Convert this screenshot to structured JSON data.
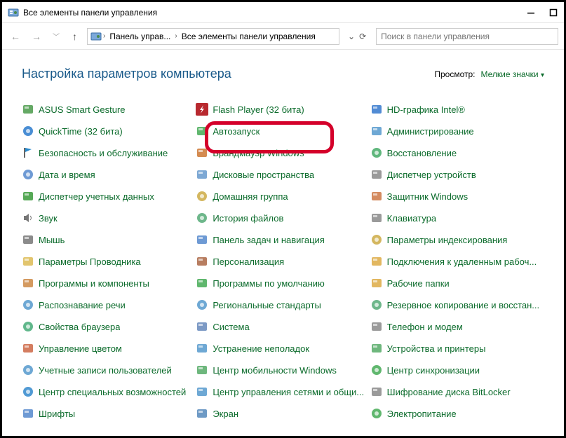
{
  "window": {
    "title": "Все элементы панели управления"
  },
  "breadcrumbs": {
    "part1": "Панель управ...",
    "part2": "Все элементы панели управления"
  },
  "search": {
    "placeholder": "Поиск в панели управления"
  },
  "page": {
    "title": "Настройка параметров компьютера"
  },
  "view": {
    "label": "Просмотр:",
    "value": "Мелкие значки"
  },
  "highlight_emphasis": true,
  "columns": [
    [
      {
        "icon": "asus-icon",
        "label": "ASUS Smart Gesture"
      },
      {
        "icon": "quicktime-icon",
        "label": "QuickTime (32 бита)"
      },
      {
        "icon": "flag-icon",
        "label": "Безопасность и обслуживание"
      },
      {
        "icon": "clock-icon",
        "label": "Дата и время"
      },
      {
        "icon": "credentials-icon",
        "label": "Диспетчер учетных данных"
      },
      {
        "icon": "sound-icon",
        "label": "Звук"
      },
      {
        "icon": "mouse-icon",
        "label": "Мышь"
      },
      {
        "icon": "explorer-options-icon",
        "label": "Параметры Проводника"
      },
      {
        "icon": "programs-icon",
        "label": "Программы и компоненты"
      },
      {
        "icon": "speech-icon",
        "label": "Распознавание речи"
      },
      {
        "icon": "browser-props-icon",
        "label": "Свойства браузера"
      },
      {
        "icon": "color-mgmt-icon",
        "label": "Управление цветом"
      },
      {
        "icon": "user-accounts-icon",
        "label": "Учетные записи пользователей"
      },
      {
        "icon": "ease-access-icon",
        "label": "Центр специальных возможностей"
      },
      {
        "icon": "fonts-icon",
        "label": "Шрифты"
      }
    ],
    [
      {
        "icon": "flash-icon",
        "label": "Flash Player (32 бита)",
        "highlighted": true
      },
      {
        "icon": "autoplay-icon",
        "label": "Автозапуск"
      },
      {
        "icon": "firewall-icon",
        "label": "Брандмауэр Windows"
      },
      {
        "icon": "storage-icon",
        "label": "Дисковые пространства"
      },
      {
        "icon": "homegroup-icon",
        "label": "Домашняя группа"
      },
      {
        "icon": "history-icon",
        "label": "История файлов"
      },
      {
        "icon": "taskbar-icon",
        "label": "Панель задач и навигация"
      },
      {
        "icon": "personalize-icon",
        "label": "Персонализация"
      },
      {
        "icon": "default-programs-icon",
        "label": "Программы по умолчанию"
      },
      {
        "icon": "region-icon",
        "label": "Региональные стандарты"
      },
      {
        "icon": "system-icon",
        "label": "Система"
      },
      {
        "icon": "troubleshoot-icon",
        "label": "Устранение неполадок"
      },
      {
        "icon": "mobility-icon",
        "label": "Центр мобильности Windows"
      },
      {
        "icon": "network-center-icon",
        "label": "Центр управления сетями и общи..."
      },
      {
        "icon": "display-icon",
        "label": "Экран"
      }
    ],
    [
      {
        "icon": "intel-hd-icon",
        "label": "HD-графика Intel®"
      },
      {
        "icon": "admin-tools-icon",
        "label": "Администрирование"
      },
      {
        "icon": "recovery-icon",
        "label": "Восстановление"
      },
      {
        "icon": "device-mgr-icon",
        "label": "Диспетчер устройств"
      },
      {
        "icon": "defender-icon",
        "label": "Защитник Windows"
      },
      {
        "icon": "keyboard-icon",
        "label": "Клавиатура"
      },
      {
        "icon": "indexing-icon",
        "label": "Параметры индексирования"
      },
      {
        "icon": "remote-desktop-icon",
        "label": "Подключения к удаленным рабоч..."
      },
      {
        "icon": "work-folders-icon",
        "label": "Рабочие папки"
      },
      {
        "icon": "backup-icon",
        "label": "Резервное копирование и восстан..."
      },
      {
        "icon": "phone-modem-icon",
        "label": "Телефон и модем"
      },
      {
        "icon": "devices-printers-icon",
        "label": "Устройства и принтеры"
      },
      {
        "icon": "sync-center-icon",
        "label": "Центр синхронизации"
      },
      {
        "icon": "bitlocker-icon",
        "label": "Шифрование диска BitLocker"
      },
      {
        "icon": "power-icon",
        "label": "Электропитание"
      }
    ]
  ]
}
